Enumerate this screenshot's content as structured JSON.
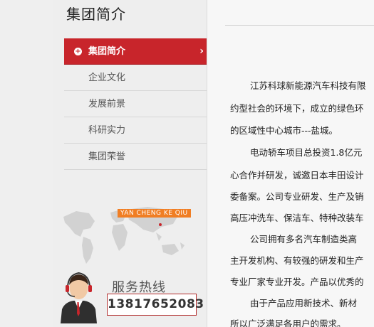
{
  "sidebar": {
    "title": "集团简介",
    "items": [
      {
        "label": "集团简介",
        "active": true
      },
      {
        "label": "企业文化",
        "active": false
      },
      {
        "label": "发展前景",
        "active": false
      },
      {
        "label": "科研实力",
        "active": false
      },
      {
        "label": "集团荣誉",
        "active": false
      }
    ],
    "map_label": "YAN CHENG KE QIU",
    "hotline_label": "服务热线",
    "hotline_number": "13817652083"
  },
  "content": {
    "lines": [
      "江苏科球新能源汽车科技有限",
      "约型社会的环境下，成立的绿色环",
      "的区域性中心城市---盐城。",
      "电动轿车项目总投资1.8亿元",
      "心合作并研发，诚邀日本丰田设计",
      "委备案。公司专业研发、生产及销",
      "高压冲洗车、保洁车、特种改装车",
      "公司拥有多名汽车制造类高",
      "主开发机构、有较强的研发和生产",
      "专业厂家专业开发。产品以优秀的",
      "由于产品应用新技术、新材",
      "所以广泛满足各用户的需求。"
    ]
  },
  "colors": {
    "accent": "#c8252b",
    "map_label_bg": "#f07e24"
  }
}
